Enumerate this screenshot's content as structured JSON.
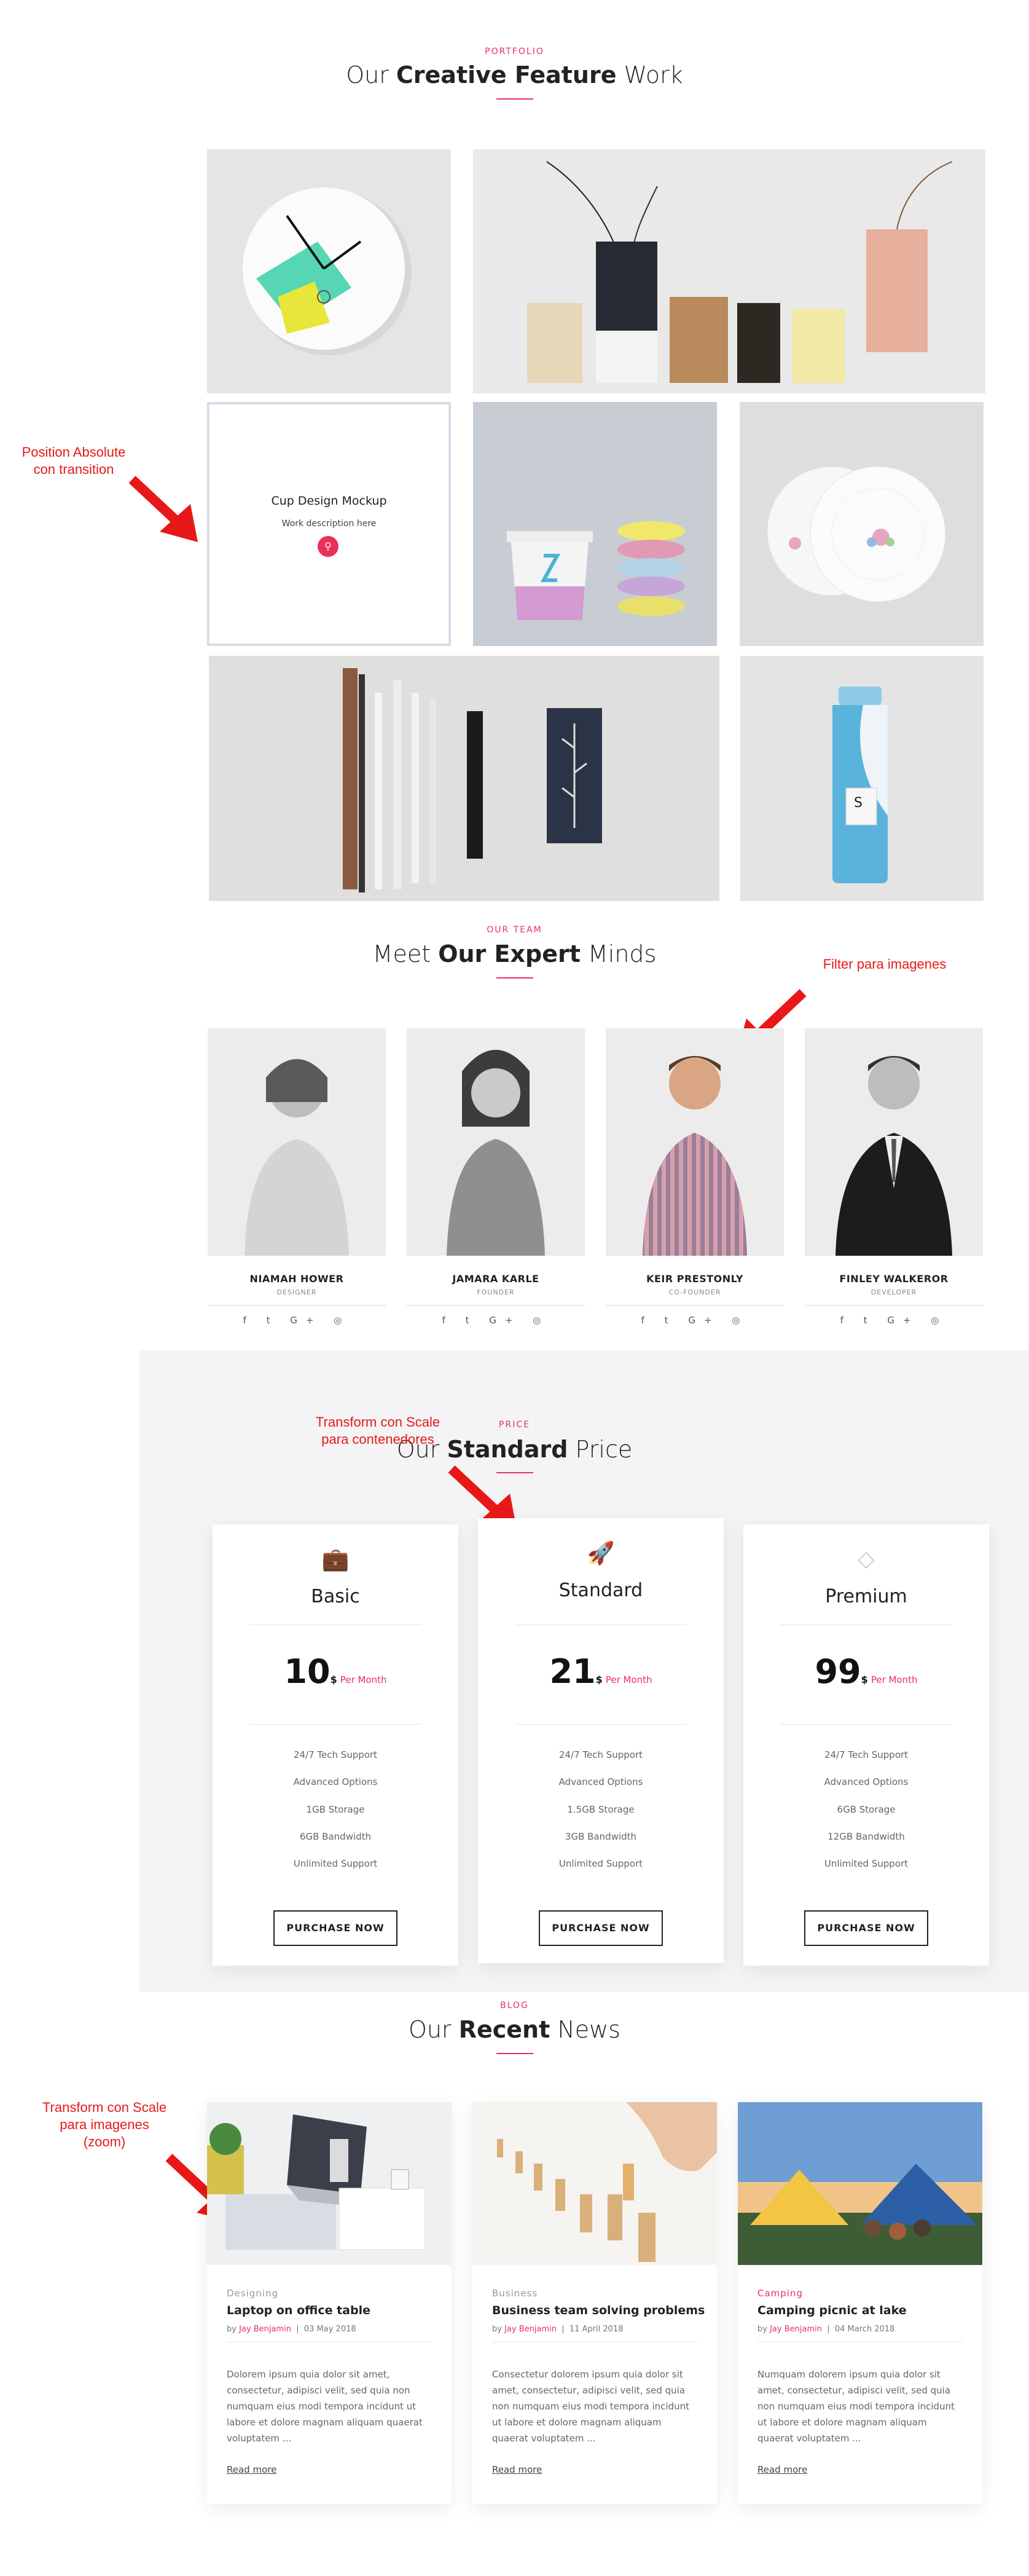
{
  "portfolio": {
    "eyebrow": "PORTFOLIO",
    "title_pre": "Our ",
    "title_bold": "Creative Feature",
    "title_post": " Work",
    "hover_title": "Cup Design Mockup",
    "hover_desc": "Work description here"
  },
  "annotations": {
    "position": "Position Absolute\ncon transition",
    "filter": "Filter para imagenes",
    "transform_scale": "Transform con Scale\npara contenedores",
    "transform_zoom": "Transform con Scale\npara imagenes\n(zoom)"
  },
  "team": {
    "eyebrow": "OUR TEAM",
    "title_pre": "Meet ",
    "title_bold": "Our Expert",
    "title_post": " Minds",
    "members": [
      {
        "name": "NIAMAH HOWER",
        "role": "DESIGNER"
      },
      {
        "name": "JAMARA KARLE",
        "role": "FOUNDER"
      },
      {
        "name": "KEIR PRESTONLY",
        "role": "CO-FOUNDER"
      },
      {
        "name": "FINLEY WALKEROR",
        "role": "DEVELOPER"
      }
    ],
    "social": "f  t  G+  ◎"
  },
  "price": {
    "eyebrow": "PRICE",
    "title_pre": "Our ",
    "title_bold": "Standard",
    "title_post": " Price",
    "plans": [
      {
        "name": "Basic",
        "price": "10",
        "currency": "$",
        "period": "Per Month",
        "features": [
          "24/7 Tech Support",
          "Advanced Options",
          "1GB Storage",
          "6GB Bandwidth",
          "Unlimited Support"
        ],
        "button": "PURCHASE NOW",
        "icon": "briefcase-icon"
      },
      {
        "name": "Standard",
        "price": "21",
        "currency": "$",
        "period": "Per Month",
        "features": [
          "24/7 Tech Support",
          "Advanced Options",
          "1.5GB Storage",
          "3GB Bandwidth",
          "Unlimited Support"
        ],
        "button": "PURCHASE NOW",
        "icon": "rocket-icon"
      },
      {
        "name": "Premium",
        "price": "99",
        "currency": "$",
        "period": "Per Month",
        "features": [
          "24/7 Tech Support",
          "Advanced Options",
          "6GB Storage",
          "12GB Bandwidth",
          "Unlimited Support"
        ],
        "button": "PURCHASE NOW",
        "icon": "diamond-icon"
      }
    ]
  },
  "blog": {
    "eyebrow": "BLOG",
    "title_pre": "Our ",
    "title_bold": "Recent",
    "title_post": " News",
    "posts": [
      {
        "category": "Designing",
        "category_color": "#999999",
        "title": "Laptop on office table",
        "author": "Jay Benjamin",
        "date": "03 May 2018",
        "text": "Dolorem ipsum quia dolor sit amet, consectetur, adipisci velit, sed quia non numquam eius modi tempora incidunt ut labore et dolore magnam aliquam quaerat voluptatem ...",
        "more": "Read more"
      },
      {
        "category": "Business",
        "category_color": "#999999",
        "title": "Business team solving problems",
        "author": "Jay Benjamin",
        "date": "11 April 2018",
        "text": "Consectetur dolorem ipsum quia dolor sit amet, consectetur, adipisci velit, sed quia non numquam eius modi tempora incidunt ut labore et dolore magnam aliquam quaerat voluptatem ...",
        "more": "Read more"
      },
      {
        "category": "Camping",
        "category_color": "#e8305a",
        "title": "Camping picnic at lake",
        "author": "Jay Benjamin",
        "date": "04 March 2018",
        "text": "Numquam dolorem ipsum quia dolor sit amet, consectetur, adipisci velit, sed quia non numquam eius modi tempora incidunt ut labore et dolore magnam aliquam quaerat voluptatem ...",
        "more": "Read more"
      }
    ]
  }
}
